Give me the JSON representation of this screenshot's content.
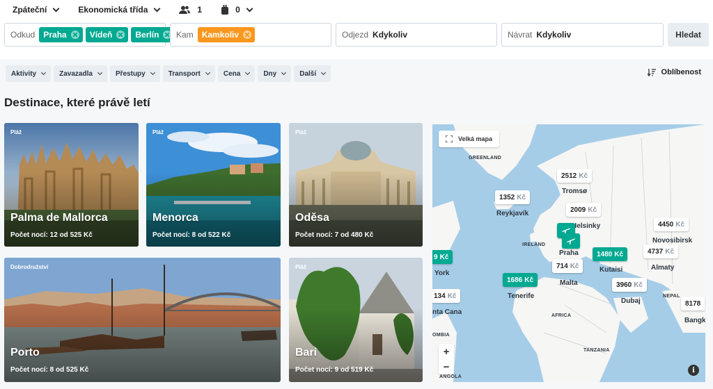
{
  "topbar": {
    "trip_type": "Zpáteční",
    "cabin_class": "Ekonomická třída",
    "passengers": "1",
    "bags": "0"
  },
  "search": {
    "from_label": "Odkud",
    "from_chips": [
      "Praha",
      "Vídeň",
      "Berlín"
    ],
    "to_label": "Kam",
    "to_chip": "Kamkoliv",
    "depart_label": "Odjezd",
    "depart_value": "Kdykoliv",
    "return_label": "Návrat",
    "return_value": "Kdykoliv",
    "search_button": "Hledat"
  },
  "filters": [
    "Aktivity",
    "Zavazadla",
    "Přestupy",
    "Transport",
    "Cena",
    "Dny",
    "Další"
  ],
  "sort_label": "Oblíbenost",
  "section_title": "Destinace, které právě letí",
  "cards": [
    {
      "tag": "Pláž",
      "city": "Palma de Mallorca",
      "info": "Počet nocí: 12 od 525 Kč"
    },
    {
      "tag": "Pláž",
      "city": "Menorca",
      "info": "Počet nocí: 8 od 522 Kč"
    },
    {
      "tag": "Pláž",
      "city": "Oděsa",
      "info": "Počet nocí: 7 od 480 Kč"
    },
    {
      "tag": "Dobrodružství",
      "city": "Porto",
      "info": "Počet nocí: 8 od 525 Kč"
    },
    {
      "tag": "Pláž",
      "city": "Bari",
      "info": "Počet nocí: 9 od 519 Kč"
    }
  ],
  "map": {
    "big_map_button": "Velká mapa",
    "currency": "Kč",
    "prices": [
      "2512",
      "1352",
      "2009",
      "4450",
      "4737",
      "1480",
      "714",
      "3960",
      "1686",
      "9",
      "134",
      "8178"
    ],
    "labels": [
      "GREENLAND",
      "Tromsø",
      "Reykjavík",
      "Helsinky",
      "Novosibirsk",
      "IRELAND",
      "Praha",
      "Almaty",
      "Kutaisi",
      "York",
      "Malta",
      "Dubaj",
      "Tenerife",
      "nta Cana",
      "AFRICA",
      "NEPAL",
      "Bangk",
      "OMBIA",
      "TANZANIA",
      "ANGOLA"
    ],
    "zoom_in": "+",
    "zoom_out": "−",
    "info": "i"
  },
  "colors": {
    "accent_green": "#00a991",
    "accent_orange": "#f9971e"
  }
}
